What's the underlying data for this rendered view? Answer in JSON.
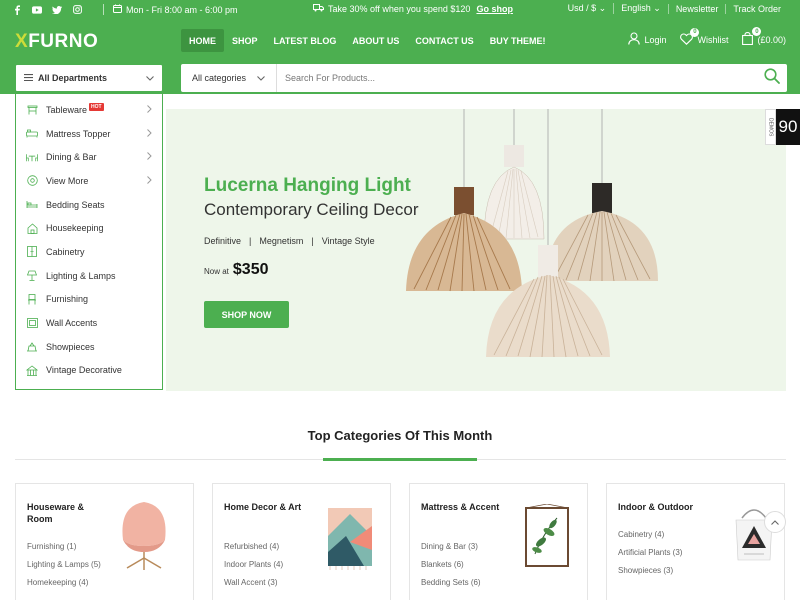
{
  "topbar": {
    "social": [
      "f",
      "yt",
      "tw",
      "ig"
    ],
    "hours": "Mon - Fri 8:00 am - 6:00 pm",
    "promo_text": "Take 30% off when you spend $120",
    "promo_link": "Go shop",
    "currency": "Usd / $",
    "language": "English",
    "newsletter": "Newsletter",
    "track_order": "Track Order"
  },
  "header": {
    "logo_x": "X",
    "logo_rest": "FURNO",
    "nav": [
      "HOME",
      "SHOP",
      "LATEST BLOG",
      "ABOUT US",
      "CONTACT US",
      "BUY THEME!"
    ],
    "login": "Login",
    "wishlist": "Wishlist",
    "wishlist_count": "0",
    "cart_count": "0",
    "cart_total": "(£0.00)"
  },
  "departments": {
    "label": "All Departments",
    "items": [
      {
        "label": "Tableware",
        "icon": "table-icon",
        "badge": "HOT",
        "arrow": true
      },
      {
        "label": "Mattress Topper",
        "icon": "mattress-icon",
        "arrow": true
      },
      {
        "label": "Dining & Bar",
        "icon": "dining-icon",
        "arrow": true
      },
      {
        "label": "View More",
        "icon": "view-more-icon",
        "arrow": true
      },
      {
        "label": "Bedding Seats",
        "icon": "bed-icon"
      },
      {
        "label": "Housekeeping",
        "icon": "housekeeping-icon"
      },
      {
        "label": "Cabinetry",
        "icon": "cabinet-icon"
      },
      {
        "label": "Lighting & Lamps",
        "icon": "lamp-icon"
      },
      {
        "label": "Furnishing",
        "icon": "furnishing-icon"
      },
      {
        "label": "Wall Accents",
        "icon": "frame-icon"
      },
      {
        "label": "Showpieces",
        "icon": "showpiece-icon"
      },
      {
        "label": "Vintage Decorative",
        "icon": "vintage-icon"
      }
    ]
  },
  "search": {
    "category": "All categories",
    "placeholder": "Search For Products..."
  },
  "hero": {
    "title": "Lucerna Hanging Light",
    "subtitle": "Contemporary Ceiling Decor",
    "features": [
      "Definitive",
      "Megnetism",
      "Vintage Style"
    ],
    "price_prefix": "Now at",
    "price": "$350",
    "cta": "SHOP NOW"
  },
  "side_widget": {
    "demos_label": "DEMOS",
    "count": "90"
  },
  "section": {
    "title": "Top Categories Of This Month"
  },
  "categories": [
    {
      "title": "Houseware & Room",
      "links": [
        "Furnishing (1)",
        "Lighting & Lamps (5)",
        "Homekeeping (4)"
      ]
    },
    {
      "title": "Home Decor & Art",
      "links": [
        "Refurbished (4)",
        "Indoor Plants (4)",
        "Wall Accent (3)"
      ]
    },
    {
      "title": "Mattress & Accent",
      "links": [
        "Dining & Bar (3)",
        "Blankets (6)",
        "Bedding Sets (6)"
      ]
    },
    {
      "title": "Indoor & Outdoor",
      "links": [
        "Cabinetry (4)",
        "Artificial Plants (3)",
        "Showpieces (3)"
      ]
    }
  ],
  "colors": {
    "brand": "#4caf50",
    "brand_dark": "#3d9440",
    "logo_accent": "#cddc39",
    "hot_badge": "#e53935",
    "hero_bg": "#eef6ea"
  }
}
